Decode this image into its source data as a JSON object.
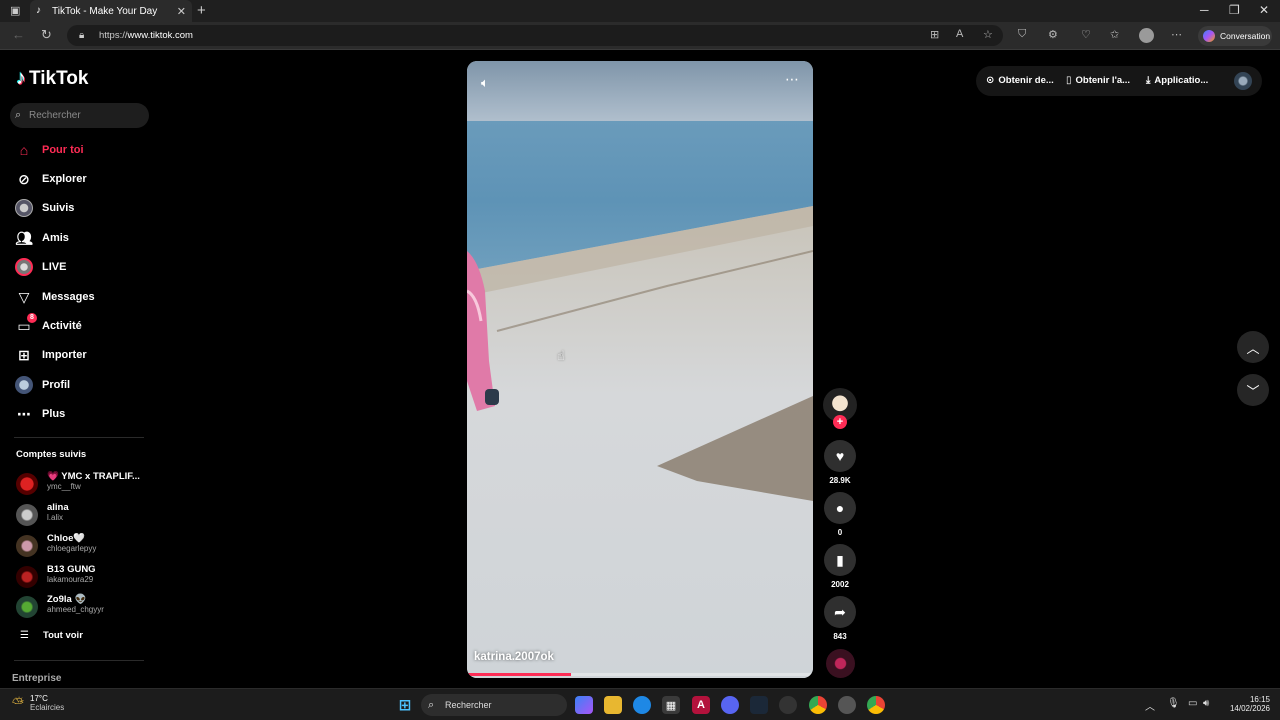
{
  "browser": {
    "tab_title": "TikTok - Make Your Day",
    "tab_favicon": "tiktok-icon",
    "url_scheme": "https://",
    "url_host": "www.tiktok.com",
    "conversation_label": "Conversation"
  },
  "sidebar": {
    "logo": "TikTok",
    "search_placeholder": "Rechercher",
    "nav": [
      {
        "label": "Pour toi",
        "icon": "home-icon",
        "active": true
      },
      {
        "label": "Explorer",
        "icon": "compass-icon"
      },
      {
        "label": "Suivis",
        "icon": "avatar-icon"
      },
      {
        "label": "Amis",
        "icon": "friends-icon"
      },
      {
        "label": "LIVE",
        "icon": "live-avatar-icon"
      },
      {
        "label": "Messages",
        "icon": "send-icon"
      },
      {
        "label": "Activité",
        "icon": "inbox-icon",
        "badge": "8"
      },
      {
        "label": "Importer",
        "icon": "upload-icon"
      },
      {
        "label": "Profil",
        "icon": "profile-avatar-icon"
      },
      {
        "label": "Plus",
        "icon": "more-icon"
      }
    ],
    "followed_header": "Comptes suivis",
    "followed": [
      {
        "name": "💗 YMC x TRAPLIF...",
        "user": "ymc__ftw"
      },
      {
        "name": "alina",
        "user": "l.alix"
      },
      {
        "name": "Chloe🤍",
        "user": "chloegarlepyy"
      },
      {
        "name": "B13 GUNG",
        "user": "lakamoura29"
      },
      {
        "name": "Zo9la 👽",
        "user": "ahmeed_chgyyr"
      }
    ],
    "see_all": "Tout voir",
    "footer": "Entreprise"
  },
  "video": {
    "author": "katrina.2007ok",
    "progress": 0.3,
    "likes": "28.9K",
    "comments": "0",
    "saves": "2002",
    "shares": "843"
  },
  "top_actions": {
    "item1": "Obtenir de...",
    "item2": "Obtenir l'a...",
    "item3": "Applicatio..."
  },
  "taskbar": {
    "temp": "17°C",
    "weather": "Eclaircies",
    "search": "Rechercher",
    "time": "16:15",
    "date": "14/02/2026"
  },
  "colors": {
    "accent": "#fe2c55",
    "background": "#000000"
  }
}
